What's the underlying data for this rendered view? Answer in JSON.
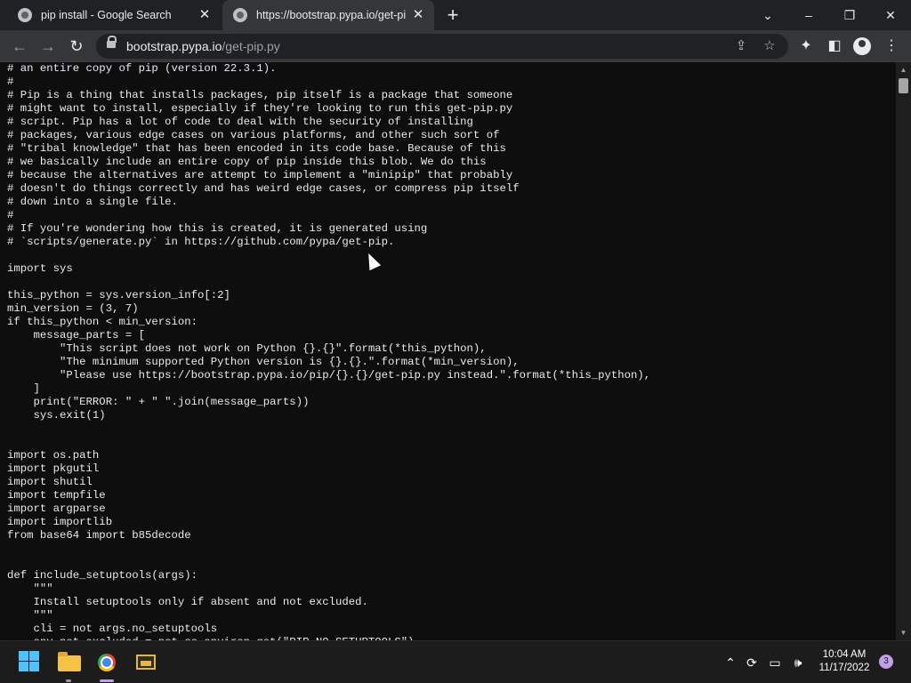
{
  "tabs": [
    {
      "title": "pip install - Google Search",
      "active": false
    },
    {
      "title": "https://bootstrap.pypa.io/get-pip.py",
      "active": true
    }
  ],
  "address_bar": {
    "host": "bootstrap.pypa.io",
    "path": "/get-pip.py"
  },
  "code_lines": [
    "# an entire copy of pip (version 22.3.1).",
    "#",
    "# Pip is a thing that installs packages, pip itself is a package that someone",
    "# might want to install, especially if they're looking to run this get-pip.py",
    "# script. Pip has a lot of code to deal with the security of installing",
    "# packages, various edge cases on various platforms, and other such sort of",
    "# \"tribal knowledge\" that has been encoded in its code base. Because of this",
    "# we basically include an entire copy of pip inside this blob. We do this",
    "# because the alternatives are attempt to implement a \"minipip\" that probably",
    "# doesn't do things correctly and has weird edge cases, or compress pip itself",
    "# down into a single file.",
    "#",
    "# If you're wondering how this is created, it is generated using",
    "# `scripts/generate.py` in https://github.com/pypa/get-pip.",
    "",
    "import sys",
    "",
    "this_python = sys.version_info[:2]",
    "min_version = (3, 7)",
    "if this_python < min_version:",
    "    message_parts = [",
    "        \"This script does not work on Python {}.{}\".format(*this_python),",
    "        \"The minimum supported Python version is {}.{}.\".format(*min_version),",
    "        \"Please use https://bootstrap.pypa.io/pip/{}.{}/get-pip.py instead.\".format(*this_python),",
    "    ]",
    "    print(\"ERROR: \" + \" \".join(message_parts))",
    "    sys.exit(1)",
    "",
    "",
    "import os.path",
    "import pkgutil",
    "import shutil",
    "import tempfile",
    "import argparse",
    "import importlib",
    "from base64 import b85decode",
    "",
    "",
    "def include_setuptools(args):",
    "    \"\"\"",
    "    Install setuptools only if absent and not excluded.",
    "    \"\"\"",
    "    cli = not args.no_setuptools",
    "    env_not_excluded = not os.environ.get(\"PIP_NO_SETUPTOOLS\")"
  ],
  "taskbar": {
    "time": "10:04 AM",
    "date": "11/17/2022",
    "notification_count": "3"
  },
  "colors": {
    "accent_chrome": "#c1a0e8",
    "windows_logo": "#4cc2ff"
  }
}
